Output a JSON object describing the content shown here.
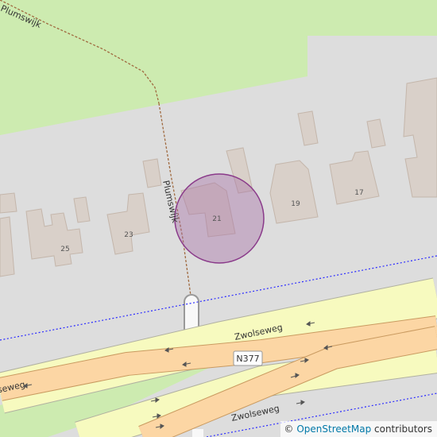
{
  "map": {
    "colors": {
      "background": "#dddddd",
      "grass": "#cdebb0",
      "building": "#d9d0c9",
      "building_outline": "#c4b6ab",
      "primary_road": "#fcd6a4",
      "secondary_road": "#f7fabf",
      "road_casing": "#b0b0a0",
      "footway": "#f8f8f8",
      "path_dash": "#a06a40",
      "boundary": "#2a2aff",
      "marker_fill": "#a56ba5",
      "marker_stroke": "#8a3a8a",
      "label_text": "#333333",
      "arrow": "#555555"
    },
    "street_labels": [
      {
        "name": "Plumswijk"
      },
      {
        "name": "Plumswijk"
      },
      {
        "name": "Zwolseweg"
      },
      {
        "name": "Zwolseweg"
      },
      {
        "name": "Zwolseweg"
      }
    ],
    "house_numbers": [
      "25",
      "23",
      "21",
      "19",
      "17"
    ],
    "road_ref": "N377",
    "marker": {
      "label": "21",
      "icon": "location-circle-marker"
    }
  },
  "attribution": {
    "copyright_symbol": "©",
    "link_text": "OpenStreetMap",
    "suffix": "contributors"
  }
}
